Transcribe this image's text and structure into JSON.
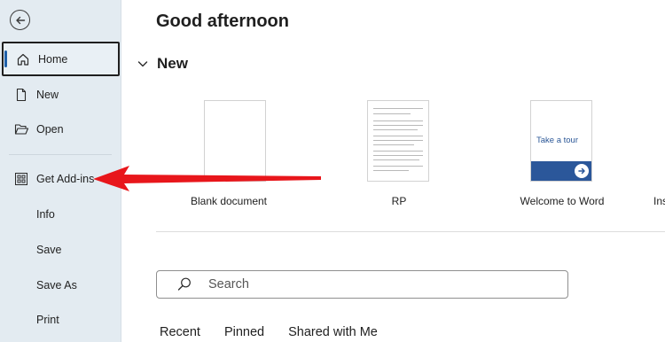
{
  "sidebar": {
    "back_icon": "arrow-left-icon",
    "items": [
      {
        "label": "Home",
        "icon": "home-icon",
        "selected": true
      },
      {
        "label": "New",
        "icon": "new-document-icon"
      },
      {
        "label": "Open",
        "icon": "folder-open-icon"
      },
      {
        "label": "Get Add-ins",
        "icon": "add-ins-grid-icon"
      },
      {
        "label": "Info"
      },
      {
        "label": "Save"
      },
      {
        "label": "Save As"
      },
      {
        "label": "Print"
      }
    ]
  },
  "main": {
    "greeting": "Good afternoon",
    "new_section": {
      "title": "New",
      "templates": [
        {
          "label": "Blank document"
        },
        {
          "label": "RP"
        },
        {
          "label": "Welcome to Word",
          "thumb_text": "Take a tour"
        },
        {
          "label": "Ins"
        }
      ]
    },
    "search": {
      "placeholder": "Search"
    },
    "tabs": [
      "Recent",
      "Pinned",
      "Shared with Me"
    ]
  },
  "colors": {
    "sidebar_bg": "#e3ebf1",
    "accent": "#2b579a",
    "annotation_arrow": "#e8161b"
  }
}
